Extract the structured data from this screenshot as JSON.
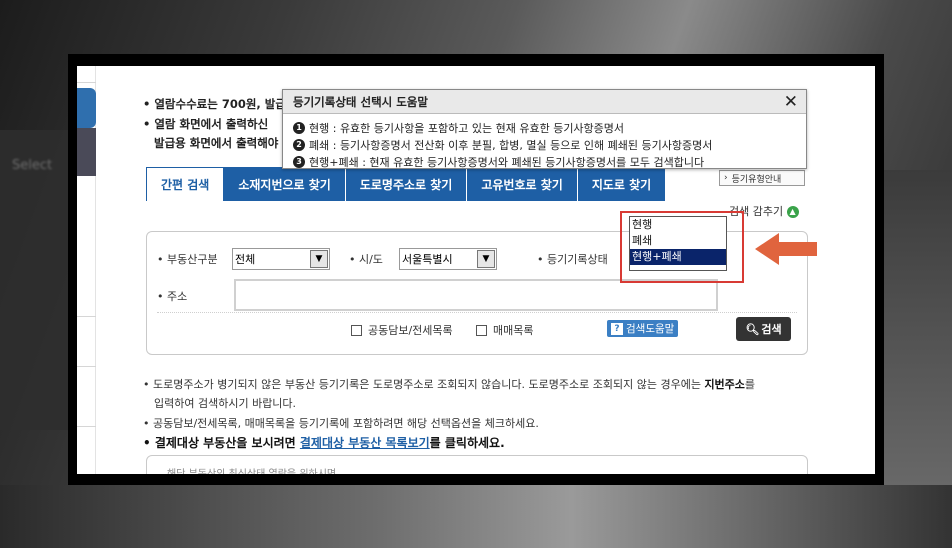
{
  "popup": {
    "title": "등기기록상태 선택시 도움말",
    "close": "✕",
    "rows": [
      {
        "num": "1",
        "text": "현행 : 유효한 등기사항을 포함하고 있는 현재 유효한 등기사항증명서"
      },
      {
        "num": "2",
        "text": "폐쇄 : 등기사항증명서 전산화 이후 분필, 합병, 멸실 등으로 인해 폐쇄된 등기사항증명서"
      },
      {
        "num": "3",
        "text": "현행+폐쇄 : 현재 유효한 등기사항증명서와 폐쇄된 등기사항증명서를 모두 검색합니다"
      }
    ]
  },
  "info": {
    "line1": "• 열람수수료는 700원, 발급",
    "line2": "• 열람 화면에서 출력하신",
    "line3": "발급용 화면에서 출력해야"
  },
  "tabs": [
    "간편 검색",
    "소재지번으로 찾기",
    "도로명주소로 찾기",
    "고유번호로 찾기",
    "지도로 찾기"
  ],
  "side_tab": "등기유형안내",
  "hide_search": "검색 감추기",
  "form": {
    "property_type_label": "• 부동산구분",
    "property_type_value": "전체",
    "city_label": "• 시/도",
    "city_value": "서울특별시",
    "status_label": "• 등기기록상태",
    "address_label": "• 주소",
    "check1": "공동담보/전세목록",
    "check2": "매매목록",
    "help_button": "검색도움말",
    "search_button": "검색"
  },
  "dropdown": {
    "options": [
      "현행",
      "폐쇄",
      "현행+폐쇄"
    ],
    "selected": "현행+폐쇄"
  },
  "notes": {
    "line1a": "• 도로명주소가 병기되지 않은 부동산 등기기록은 도로명주소로 조회되지 않습니다. 도로명주소로 조회되지 않는 경우에는 ",
    "line1b": "지번주소",
    "line1c": "를",
    "line2": "입력하여 검색하시기 바랍니다.",
    "line3": "• 공동담보/전세목록, 매매목록을 등기기록에 포함하려면 해당 선택옵션을 체크하세요.",
    "line4a": "• 결제대상 부동산을 보시려면 ",
    "line4b": "결제대상 부동산 목록보기",
    "line4c": "를 클릭하세요."
  },
  "bottom_hint": "해당 부동산의 최신상태 열람을 위하시면 ..."
}
